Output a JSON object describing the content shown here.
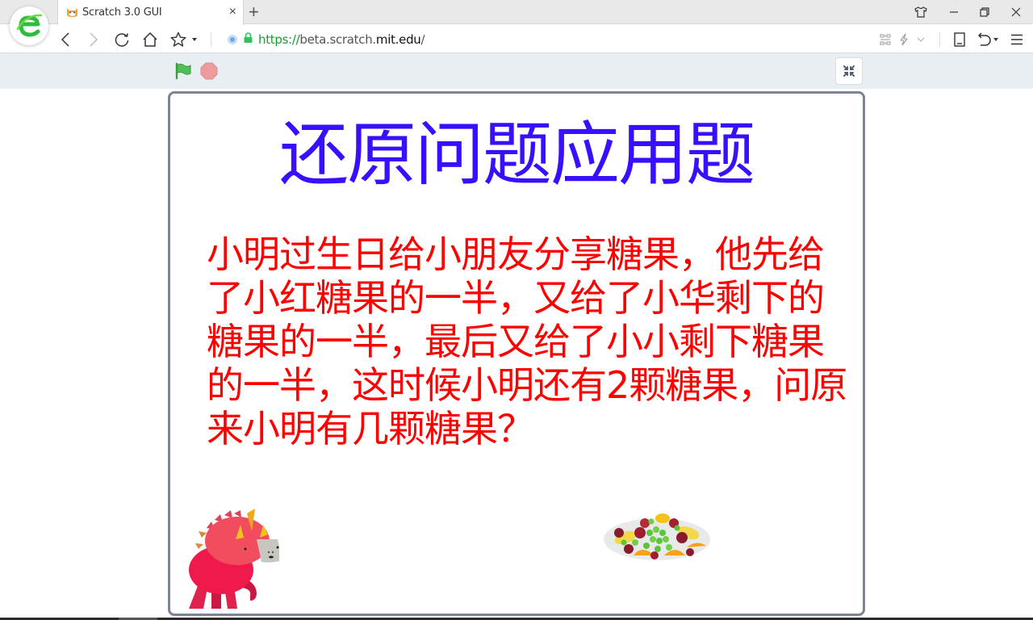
{
  "browser": {
    "tab": {
      "title": "Scratch 3.0 GUI",
      "favicon": "scratch-cat-icon",
      "close_label": "×"
    },
    "new_tab_label": "+",
    "window_controls": [
      "skin-icon",
      "minimize-icon",
      "restore-icon",
      "close-icon"
    ],
    "nav_icons": [
      "back-icon",
      "forward-icon",
      "reload-icon",
      "home-icon",
      "bookmark-star-icon"
    ],
    "address": {
      "scheme": "https://",
      "host_prefix": "beta.scratch.",
      "host_main": "mit.edu",
      "path": "/",
      "secure": true
    },
    "right_icons": [
      "qr-code-icon",
      "lightning-icon",
      "chevron-down-icon",
      "reading-mode-icon",
      "undo-icon",
      "menu-icon"
    ]
  },
  "stage_header": {
    "green_flag_label": "Green Flag",
    "stop_label": "Stop",
    "unfullscreen_label": "Exit full screen",
    "colors": {
      "flag": "#4cbf56",
      "stop": "#ec9c9c"
    }
  },
  "stage": {
    "title": "还原问题应用题",
    "question_lines": [
      "小明过生日给小朋友分享糖果，他先给",
      "了小红糖果的一半，又给了小华剩下的",
      "糖果的一半，最后又给了小小剩下糖果",
      "的一半，这时候小明还有2颗糖果，问原",
      "来小明有几颗糖果？"
    ],
    "colors": {
      "title": "#3a0fff",
      "question": "#ff0000",
      "border": "#7d8595"
    },
    "sprites": [
      {
        "name": "dinosaur",
        "icon": "dinosaur-sprite"
      },
      {
        "name": "fruit-platter",
        "icon": "fruit-platter-sprite"
      }
    ]
  }
}
